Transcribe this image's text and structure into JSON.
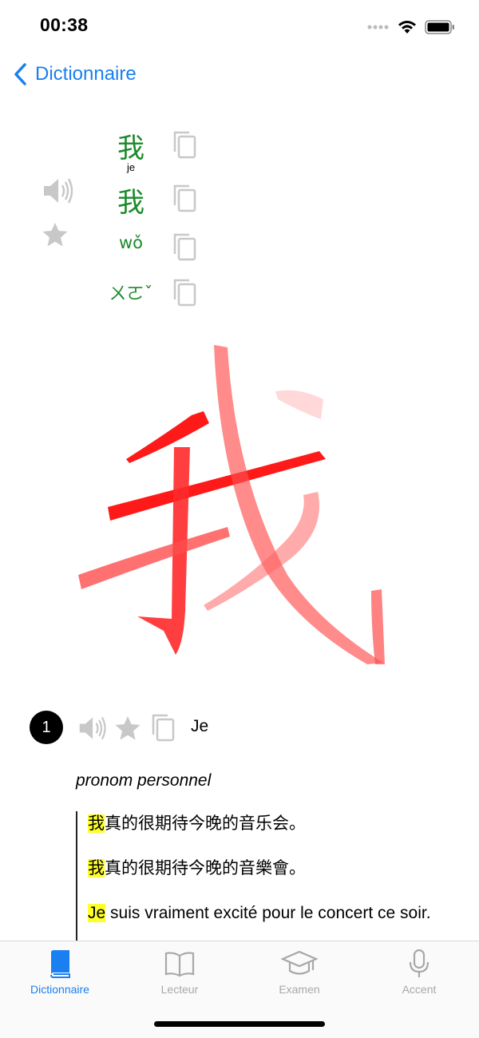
{
  "status_bar": {
    "time": "00:38"
  },
  "nav": {
    "back_label": "Dictionnaire"
  },
  "entry": {
    "simplified": "我",
    "ruby_gloss": "je",
    "traditional": "我",
    "pinyin": "wǒ",
    "zhuyin": "ㄨㄛˇ",
    "stroke_character": "我"
  },
  "definition": {
    "number": "1",
    "meaning": "Je",
    "part_of_speech": "pronom personnel",
    "examples": [
      {
        "highlight": "我",
        "rest": "真的很期待今晚的音乐会。"
      },
      {
        "highlight": "我",
        "rest": "真的很期待今晚的音樂會。"
      },
      {
        "highlight": "Je",
        "rest": " suis vraiment excité pour le concert ce soir."
      }
    ]
  },
  "tab_bar": {
    "tabs": [
      {
        "label": "Dictionnaire",
        "icon": "book-icon",
        "active": true
      },
      {
        "label": "Lecteur",
        "icon": "open-book-icon",
        "active": false
      },
      {
        "label": "Examen",
        "icon": "graduation-cap-icon",
        "active": false
      },
      {
        "label": "Accent",
        "icon": "microphone-icon",
        "active": false
      }
    ]
  },
  "colors": {
    "accent": "#1a7ff0",
    "chinese_text": "#1a8a2a",
    "stroke_red": "#ff1a1a",
    "highlight": "#ffff2a",
    "icon_gray": "#c8c8c8"
  }
}
